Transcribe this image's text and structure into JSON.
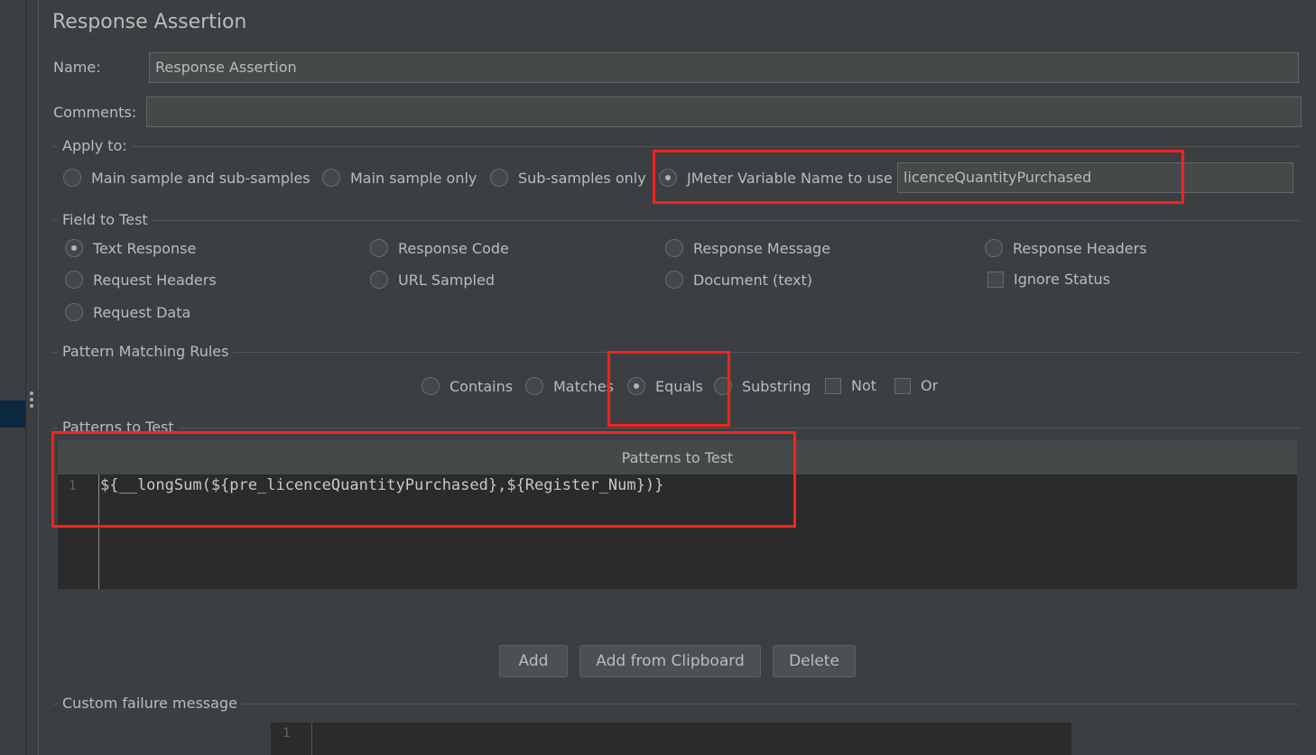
{
  "panel": {
    "title": "Response Assertion"
  },
  "name": {
    "label": "Name:",
    "value": "Response Assertion"
  },
  "comments": {
    "label": "Comments:",
    "value": ""
  },
  "apply_to": {
    "title": "Apply to:",
    "options": [
      {
        "label": "Main sample and sub-samples",
        "selected": false
      },
      {
        "label": "Main sample only",
        "selected": false
      },
      {
        "label": "Sub-samples only",
        "selected": false
      },
      {
        "label": "JMeter Variable Name to use",
        "selected": true
      }
    ],
    "variable_value": "licenceQuantityPurchased"
  },
  "field_to_test": {
    "title": "Field to Test",
    "options": [
      {
        "label": "Text Response",
        "selected": true
      },
      {
        "label": "Response Code",
        "selected": false
      },
      {
        "label": "Response Message",
        "selected": false
      },
      {
        "label": "Response Headers",
        "selected": false
      },
      {
        "label": "Request Headers",
        "selected": false
      },
      {
        "label": "URL Sampled",
        "selected": false
      },
      {
        "label": "Document (text)",
        "selected": false
      },
      {
        "label": "Request Data",
        "selected": false
      }
    ],
    "ignore_status": {
      "label": "Ignore Status",
      "checked": false
    }
  },
  "pattern_rules": {
    "title": "Pattern Matching Rules",
    "options": [
      {
        "label": "Contains",
        "selected": false
      },
      {
        "label": "Matches",
        "selected": false
      },
      {
        "label": "Equals",
        "selected": true
      },
      {
        "label": "Substring",
        "selected": false
      }
    ],
    "not": {
      "label": "Not",
      "checked": false
    },
    "or": {
      "label": "Or",
      "checked": false
    }
  },
  "patterns": {
    "section_title": "Patterns to Test",
    "column_header": "Patterns to Test",
    "rows": [
      {
        "line": "1",
        "text": "${__longSum(${pre_licenceQuantityPurchased},${Register_Num})}"
      }
    ]
  },
  "buttons": {
    "add": "Add",
    "add_clipboard": "Add from Clipboard",
    "delete": "Delete"
  },
  "failure_message": {
    "title": "Custom failure message",
    "line": "1",
    "value": ""
  },
  "colors": {
    "background": "#3c3f41",
    "field": "#45494a",
    "editor": "#2b2b2b",
    "highlight": "#ff2020"
  }
}
